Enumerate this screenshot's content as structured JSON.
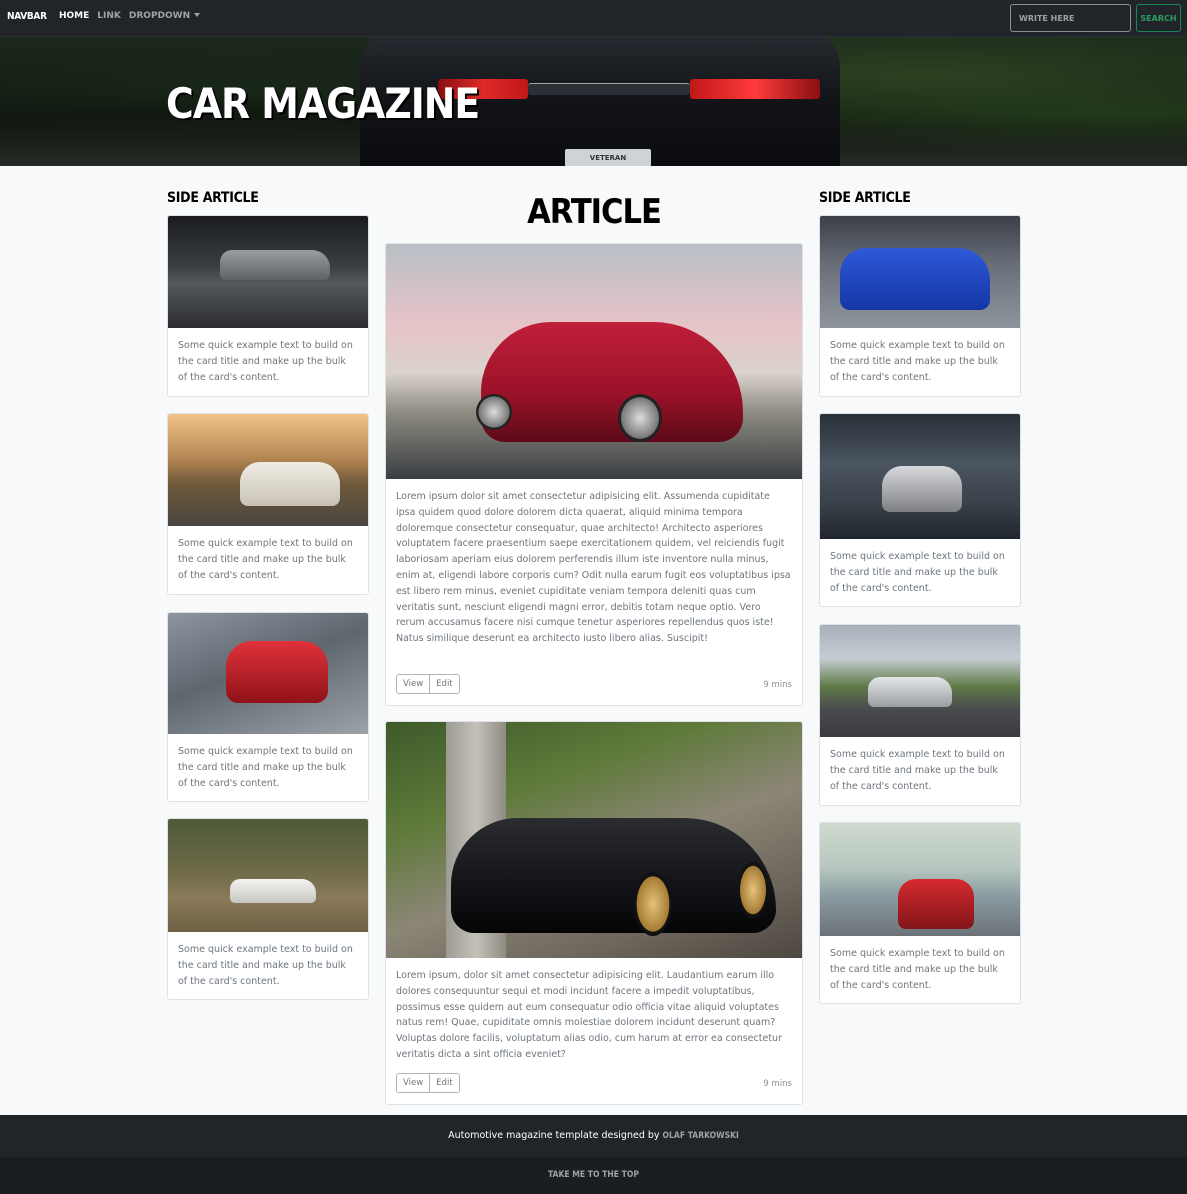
{
  "navbar": {
    "brand": "NAVBAR",
    "items": [
      {
        "label": "HOME",
        "active": true
      },
      {
        "label": "LINK",
        "active": false
      },
      {
        "label": "DROPDOWN",
        "active": false
      }
    ],
    "search_placeholder": "WRITE HERE",
    "search_button": "SEARCH"
  },
  "hero": {
    "title": "CAR MAGAZINE",
    "plate_text": "VETERAN"
  },
  "left": {
    "title": "SIDE ARTICLE",
    "cards": [
      {
        "text": "Some quick example text to build on the card title and make up the bulk of the card's content."
      },
      {
        "text": "Some quick example text to build on the card title and make up the bulk of the card's content."
      },
      {
        "text": "Some quick example text to build on the card title and make up the bulk of the card's content."
      },
      {
        "text": "Some quick example text to build on the card title and make up the bulk of the card's content."
      }
    ]
  },
  "main": {
    "title": "ARTICLE",
    "articles": [
      {
        "body": "Lorem ipsum dolor sit amet consectetur adipisicing elit. Assumenda cupiditate ipsa quidem quod dolore dolorem dicta quaerat, aliquid minima tempora doloremque consectetur consequatur, quae architecto! Architecto asperiores voluptatem facere praesentium saepe exercitationem quidem, vel reiciendis fugit laboriosam aperiam eius dolorem perferendis illum iste inventore nulla minus, enim at, eligendi labore corporis cum? Odit nulla earum fugit eos voluptatibus ipsa est libero rem minus, eveniet cupiditate veniam tempora deleniti quas cum veritatis sunt, nesciunt eligendi magni error, debitis totam neque optio. Vero rerum accusamus facere nisi cumque tenetur asperiores repellendus quos iste! Natus similique deserunt ea architecto iusto libero alias. Suscipit!",
        "view": "View",
        "edit": "Edit",
        "time": "9 mins"
      },
      {
        "body": "Lorem ipsum, dolor sit amet consectetur adipisicing elit. Laudantium earum illo dolores consequuntur sequi et modi incidunt facere a impedit voluptatibus, possimus esse quidem aut eum consequatur odio officia vitae aliquid voluptates natus rem! Quae, cupiditate omnis molestiae dolorem incidunt deserunt quam? Voluptas dolore facilis, voluptatum alias odio, cum harum at error ea consectetur veritatis dicta a sint officia eveniet?",
        "view": "View",
        "edit": "Edit",
        "time": "9 mins"
      }
    ]
  },
  "right": {
    "title": "SIDE ARTICLE",
    "cards": [
      {
        "text": "Some quick example text to build on the card title and make up the bulk of the card's content."
      },
      {
        "text": "Some quick example text to build on the card title and make up the bulk of the card's content."
      },
      {
        "text": "Some quick example text to build on the card title and make up the bulk of the card's content."
      },
      {
        "text": "Some quick example text to build on the card title and make up the bulk of the card's content."
      }
    ]
  },
  "footer": {
    "text": "Automotive magazine template designed by ",
    "author": "OLAF TARKOWSKI",
    "top_link": "TAKE ME TO THE TOP"
  },
  "colors": {
    "navbar_bg": "#212529",
    "search_accent": "#198754",
    "page_bg": "#f8f9fa"
  }
}
